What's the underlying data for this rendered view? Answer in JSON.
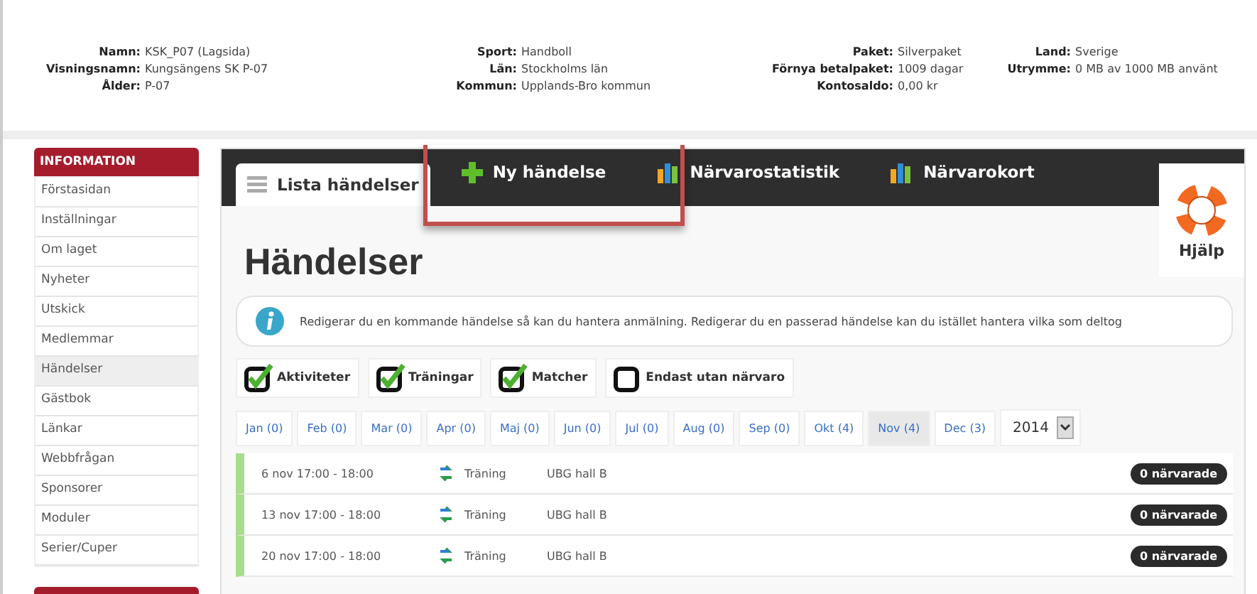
{
  "header": [
    {
      "fields": [
        {
          "label": "Namn:",
          "value": "KSK_P07 (Lagsida)"
        },
        {
          "label": "Visningsnamn:",
          "value": "Kungsängens SK P-07"
        },
        {
          "label": "Ålder:",
          "value": "P-07"
        }
      ]
    },
    {
      "fields": [
        {
          "label": "Sport:",
          "value": "Handboll"
        },
        {
          "label": "Län:",
          "value": "Stockholms län"
        },
        {
          "label": "Kommun:",
          "value": "Upplands-Bro kommun"
        }
      ]
    },
    {
      "fields": [
        {
          "label": "Paket:",
          "value": "Silverpaket"
        },
        {
          "label": "Förnya betalpaket:",
          "value": "1009 dagar"
        },
        {
          "label": "Kontosaldo:",
          "value": "0,00 kr"
        }
      ]
    },
    {
      "fields": [
        {
          "label": "Land:",
          "value": "Sverige"
        },
        {
          "label": "Utrymme:",
          "value": "0 MB av 1000 MB använt"
        }
      ]
    }
  ],
  "sidebar": {
    "title": "INFORMATION",
    "items": [
      {
        "label": "Förstasidan",
        "selected": false
      },
      {
        "label": "Inställningar",
        "selected": false
      },
      {
        "label": "Om laget",
        "selected": false
      },
      {
        "label": "Nyheter",
        "selected": false
      },
      {
        "label": "Utskick",
        "selected": false
      },
      {
        "label": "Medlemmar",
        "selected": false
      },
      {
        "label": "Händelser",
        "selected": true
      },
      {
        "label": "Gästbok",
        "selected": false
      },
      {
        "label": "Länkar",
        "selected": false
      },
      {
        "label": "Webbfrågan",
        "selected": false
      },
      {
        "label": "Sponsorer",
        "selected": false
      },
      {
        "label": "Moduler",
        "selected": false
      },
      {
        "label": "Serier/Cuper",
        "selected": false
      }
    ]
  },
  "tabs": [
    {
      "label": "Lista händelser",
      "kind": "list",
      "selected": true
    },
    {
      "label": "Ny händelse",
      "kind": "add",
      "selected": false
    },
    {
      "label": "Närvarostatistik",
      "kind": "chart",
      "selected": false
    },
    {
      "label": "Närvarokort",
      "kind": "chart",
      "selected": false
    }
  ],
  "help": {
    "label": "Hjälp"
  },
  "heading": "Händelser",
  "info": "Redigerar du en kommande händelse så kan du hantera anmälning. Redigerar du en passerad händelse kan du istället hantera vilka som deltog",
  "filters": [
    {
      "label": "Aktiviteter",
      "checked": true
    },
    {
      "label": "Träningar",
      "checked": true
    },
    {
      "label": "Matcher",
      "checked": true
    },
    {
      "label": "Endast utan närvaro",
      "checked": false
    }
  ],
  "months": [
    {
      "label": "Jan (0)",
      "selected": false
    },
    {
      "label": "Feb (0)",
      "selected": false
    },
    {
      "label": "Mar (0)",
      "selected": false
    },
    {
      "label": "Apr (0)",
      "selected": false
    },
    {
      "label": "Maj (0)",
      "selected": false
    },
    {
      "label": "Jun (0)",
      "selected": false
    },
    {
      "label": "Jul (0)",
      "selected": false
    },
    {
      "label": "Aug (0)",
      "selected": false
    },
    {
      "label": "Sep (0)",
      "selected": false
    },
    {
      "label": "Okt (4)",
      "selected": false
    },
    {
      "label": "Nov (4)",
      "selected": true
    },
    {
      "label": "Dec (3)",
      "selected": false
    }
  ],
  "year": "2014",
  "events": [
    {
      "time": "6 nov 17:00 - 18:00",
      "type": "Träning",
      "place": "UBG hall B",
      "attendance": "0 närvarade"
    },
    {
      "time": "13 nov 17:00 - 18:00",
      "type": "Träning",
      "place": "UBG hall B",
      "attendance": "0 närvarade"
    },
    {
      "time": "20 nov 17:00 - 18:00",
      "type": "Träning",
      "place": "UBG hall B",
      "attendance": "0 närvarade"
    }
  ]
}
